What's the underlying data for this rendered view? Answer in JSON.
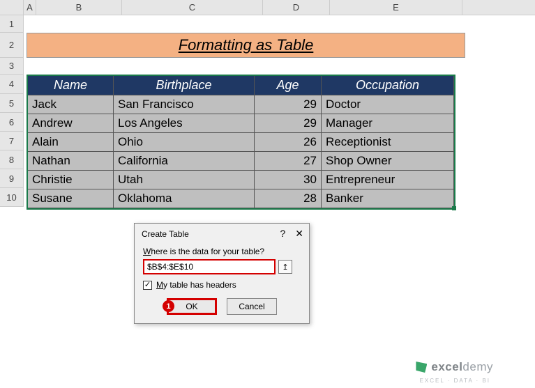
{
  "columns": {
    "A": "A",
    "B": "B",
    "C": "C",
    "D": "D",
    "E": "E"
  },
  "rows": [
    "1",
    "2",
    "3",
    "4",
    "5",
    "6",
    "7",
    "8",
    "9",
    "10"
  ],
  "title": "Formatting as Table",
  "table": {
    "headers": {
      "name": "Name",
      "birthplace": "Birthplace",
      "age": "Age",
      "occupation": "Occupation"
    },
    "rows": [
      {
        "name": "Jack",
        "birthplace": "San Francisco",
        "age": "29",
        "occupation": "Doctor"
      },
      {
        "name": "Andrew",
        "birthplace": "Los Angeles",
        "age": "29",
        "occupation": "Manager"
      },
      {
        "name": "Alain",
        "birthplace": "Ohio",
        "age": "26",
        "occupation": "Receptionist"
      },
      {
        "name": "Nathan",
        "birthplace": "California",
        "age": "27",
        "occupation": "Shop Owner"
      },
      {
        "name": "Christie",
        "birthplace": "Utah",
        "age": "30",
        "occupation": "Entrepreneur"
      },
      {
        "name": "Susane",
        "birthplace": "Oklahoma",
        "age": "28",
        "occupation": "Banker"
      }
    ]
  },
  "dialog": {
    "title": "Create Table",
    "help": "?",
    "close": "✕",
    "question_prefix": "W",
    "question_rest": "here is the data for your table?",
    "range_value": "$B$4:$E$10",
    "range_picker": "↥",
    "checkbox_checked": "✓",
    "checkbox_label_prefix": "M",
    "checkbox_label_rest": "y table has headers",
    "ok": "OK",
    "cancel": "Cancel",
    "callout": "1"
  },
  "brand": {
    "name_strong": "excel",
    "name_rest": "demy",
    "tag": "EXCEL · DATA · BI"
  }
}
